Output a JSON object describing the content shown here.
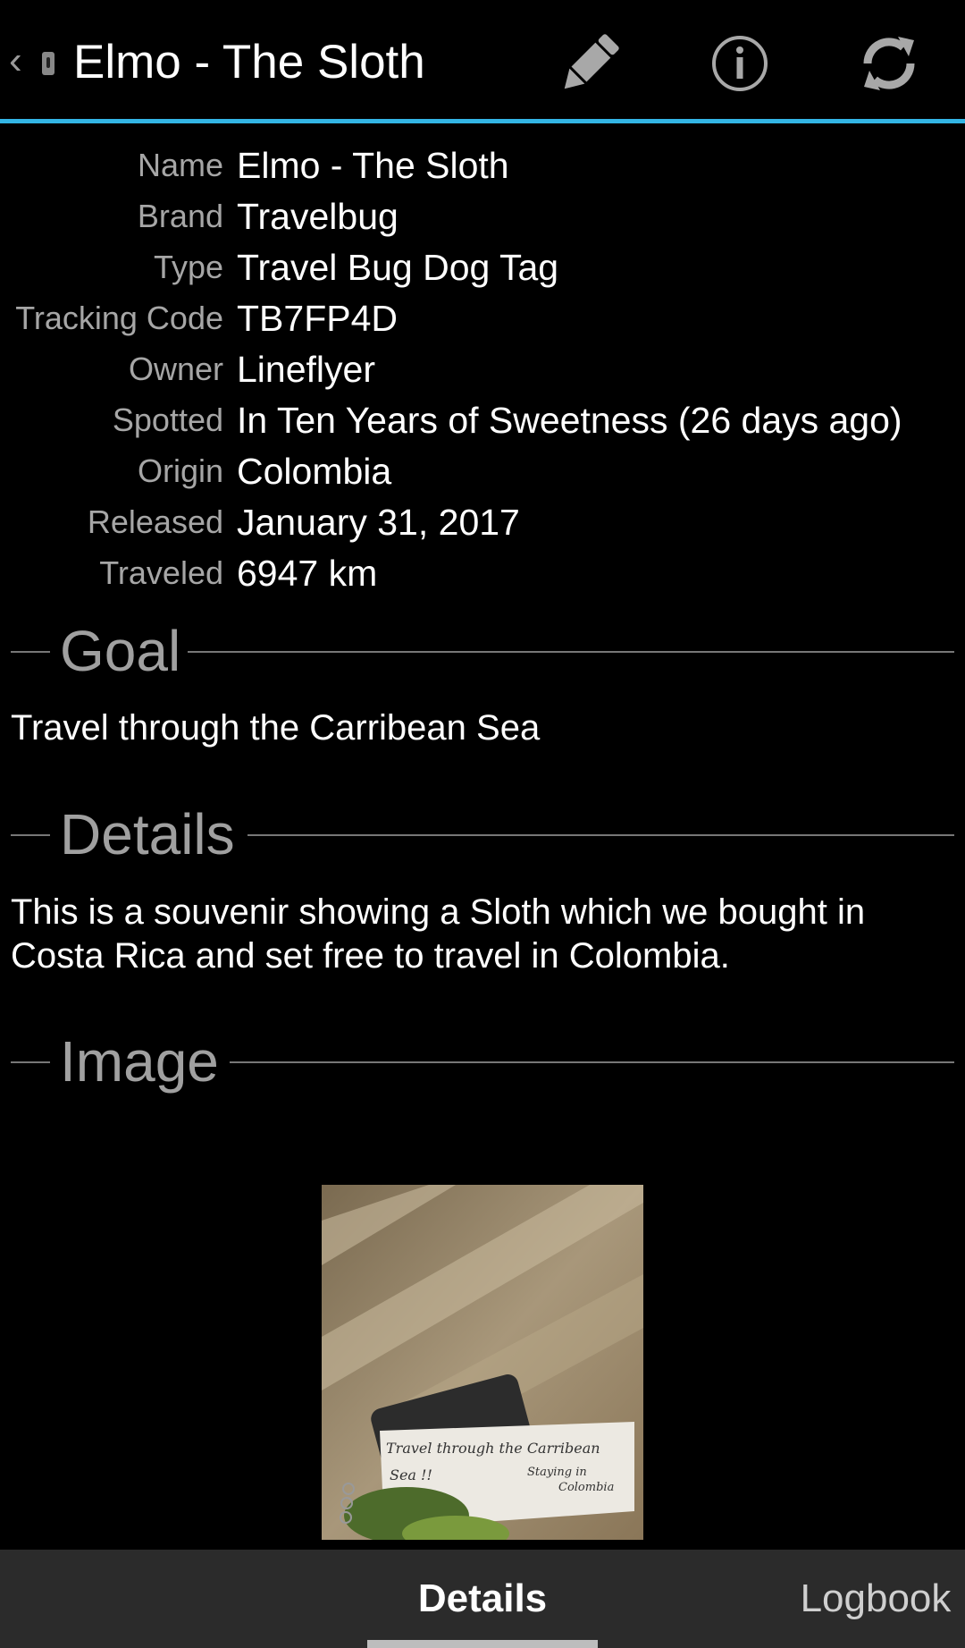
{
  "actionbar": {
    "title": "Elmo - The Sloth",
    "actions": [
      {
        "icon": "pencil-icon",
        "label": "Edit"
      },
      {
        "icon": "info-icon",
        "label": "Info"
      },
      {
        "icon": "refresh-icon",
        "label": "Refresh"
      }
    ],
    "accent_color": "#33b5e5"
  },
  "details": [
    {
      "label": "Name",
      "value": "Elmo - The Sloth"
    },
    {
      "label": "Brand",
      "value": "Travelbug"
    },
    {
      "label": "Type",
      "value": "Travel Bug Dog Tag"
    },
    {
      "label": "Tracking Code",
      "value": "TB7FP4D"
    },
    {
      "label": "Owner",
      "value": "Lineflyer"
    },
    {
      "label": "Spotted",
      "value": "In Ten Years of Sweetness (26 days ago)"
    },
    {
      "label": "Origin",
      "value": "Colombia"
    },
    {
      "label": "Released",
      "value": "January 31, 2017"
    },
    {
      "label": "Traveled",
      "value": "6947 km"
    }
  ],
  "sections": {
    "goal": {
      "title": "Goal",
      "text": "Travel through the Carribean Sea"
    },
    "details": {
      "title": "Details",
      "text": "This is a souvenir showing a Sloth which we bought in Costa Rica and set free to travel in Colombia."
    },
    "image": {
      "title": "Image"
    }
  },
  "photo": {
    "note_line1": "Travel through the Carribean",
    "note_line2": "Sea !!",
    "note_line3": "Staying in",
    "note_line4": "Colombia"
  },
  "tabs": [
    {
      "label": "Details",
      "active": true
    },
    {
      "label": "Logbook",
      "active": false
    }
  ]
}
